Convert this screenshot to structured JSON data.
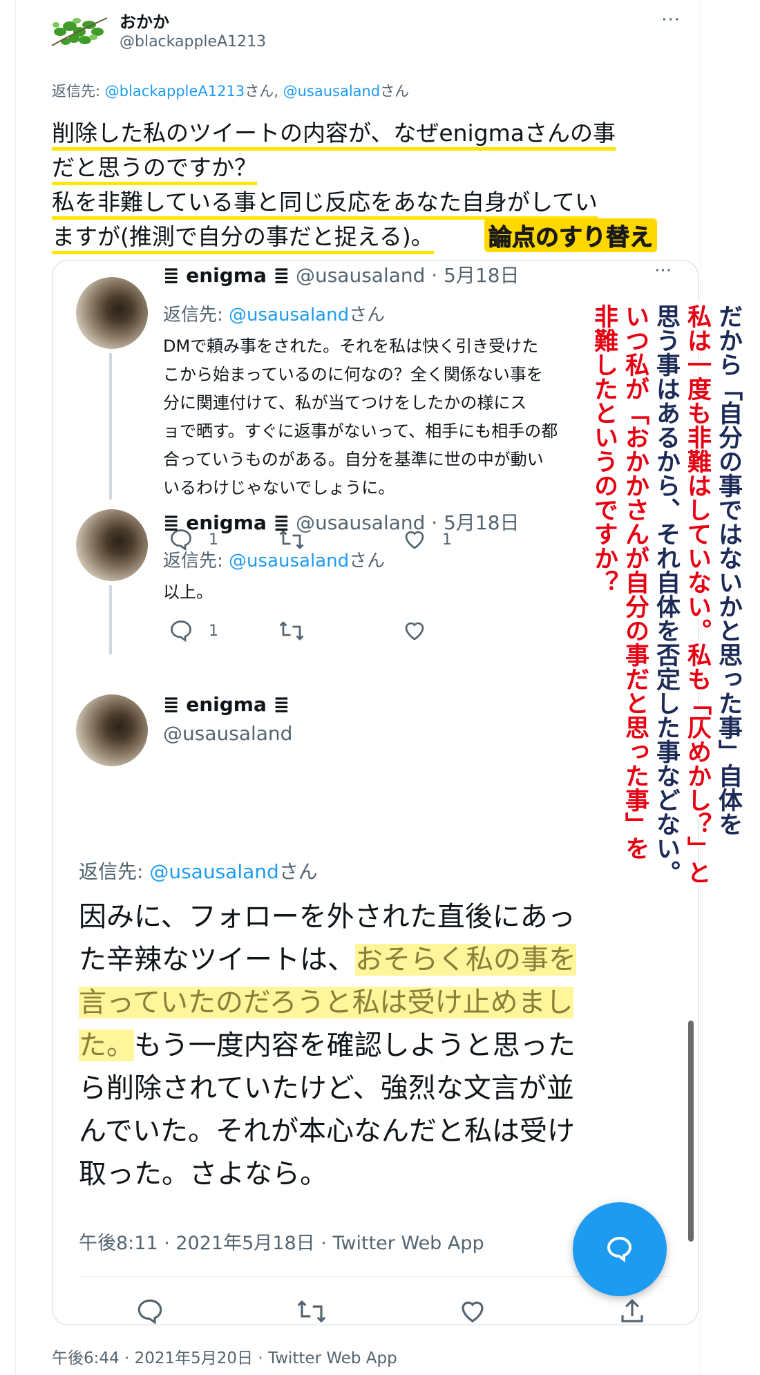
{
  "tweet": {
    "author_name": "おかか",
    "author_handle": "@blackappleA1213",
    "more_label": "···",
    "reply_prefix": "返信先: ",
    "reply_mention_1": "@blackappleA1213",
    "reply_suffix_1": "さん, ",
    "reply_mention_2": "@usausaland",
    "reply_suffix_2": "さん",
    "lines": [
      "削除した私のツイートの内容が、なぜenigmaさんの事",
      "だと思うのですか？",
      "私を非難している事と同じ反応をあなた自身がしてい",
      "ますが(推測で自分の事だと捉える)。"
    ],
    "annotation_label": "論点のすり替え",
    "footer_time": "午後6:44 · 2021年5月20日 · Twitter Web App"
  },
  "quote": {
    "tweets": [
      {
        "name": "≣ enigma ≣",
        "handle_date": " @usausaland · 5月18日",
        "more": "···",
        "reply_prefix": "返信先: ",
        "reply_mention": "@usausaland",
        "reply_suffix": "さん",
        "lines": [
          "DMで頼み事をされた。それを私は快く引き受けた",
          "こから始まっているのに何なの？全く関係ない事を",
          "分に関連付けて、私が当てつけをしたかの様にス",
          "ョで晒す。すぐに返事がないって、相手にも相手の都",
          "合っていうものがある。自分を基準に世の中が動い",
          "いるわけじゃないでしょうに。"
        ],
        "reply_count": "1",
        "like_count": "1"
      },
      {
        "name": "≣ enigma ≣",
        "handle_date": " @usausaland · 5月18日",
        "reply_prefix": "返信先: ",
        "reply_mention": "@usausaland",
        "reply_suffix": "さん",
        "text": "以上。",
        "reply_count": "1"
      },
      {
        "name": "≣ enigma ≣",
        "handle": "@usausaland",
        "reply_prefix": "返信先: ",
        "reply_mention": "@usausaland",
        "reply_suffix": "さん",
        "line1a": "因みに、フォローを外された直後にあっ",
        "line2a": "た辛辣なツイートは、",
        "line2b": "おそらく私の事を",
        "line3": "言っていたのだろうと私は受け止めまし",
        "line4a": "た。",
        "line4b": "もう一度内容を確認しようと思った",
        "line5": "ら削除されていたけど、強烈な文言が並",
        "line6": "んでいた。それが本心なんだと私は受け",
        "line7": "取った。さよなら。",
        "timestamp": "午後8:11 · 2021年5月18日 · Twitter Web App"
      }
    ]
  },
  "overlay": {
    "col1": "だから「自分の事ではないかと思った事」自体を",
    "col2": "私は一度も非難はしていない。私も「仄めかし？」と",
    "col3": "思う事はあるから、それ自体を否定した事などない。",
    "col4": "いつ私が「おかかさんが自分の事だと思った事」を",
    "col5": "非難したというのですか？"
  },
  "colors": {
    "accent": "#1d9bf0",
    "highlight_underline": "#ffe600",
    "overlay_red": "#e60012",
    "overlay_navy": "#1b2a56"
  },
  "icons": [
    "reply-icon",
    "retweet-icon",
    "like-icon",
    "share-icon",
    "compose-icon",
    "more-icon"
  ]
}
